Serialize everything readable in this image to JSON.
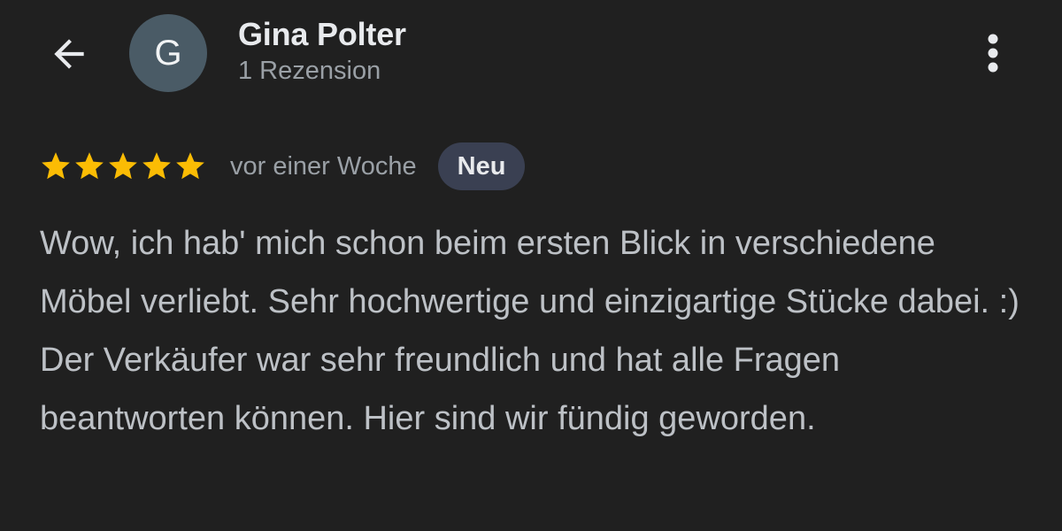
{
  "header": {
    "back_icon": "arrow-left-icon",
    "avatar_letter": "G",
    "avatar_color": "#4a5b66",
    "user_name": "Gina Polter",
    "review_count": "1 Rezension",
    "more_icon": "more-vert-icon"
  },
  "review": {
    "rating": 5,
    "max_rating": 5,
    "star_color": "#fbbc04",
    "time": "vor einer Woche",
    "badge": "Neu",
    "text": "Wow, ich hab' mich schon beim ersten Blick in verschiedene Möbel verliebt. Sehr hochwertige und einzigartige Stücke dabei. :) Der Verkäufer war sehr freundlich und hat alle Fragen beantworten können. Hier sind wir fündig geworden."
  },
  "colors": {
    "background": "#202020",
    "primary_text": "#e8eaed",
    "secondary_text": "#9aa0a6",
    "body_text": "#bdc1c6",
    "badge_background": "#3a4052"
  }
}
